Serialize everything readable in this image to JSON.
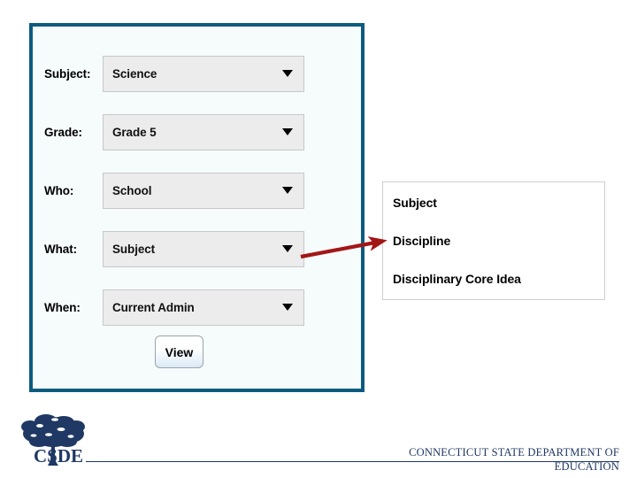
{
  "panel": {
    "title_bar": "",
    "rows": [
      {
        "label": "Subject:",
        "value": "Science",
        "name": "subject"
      },
      {
        "label": "Grade:",
        "value": "Grade 5",
        "name": "grade"
      },
      {
        "label": "Who:",
        "value": "School",
        "name": "who"
      },
      {
        "label": "What:",
        "value": "Subject",
        "name": "what"
      },
      {
        "label": "When:",
        "value": "Current Admin",
        "name": "when"
      }
    ],
    "view_button_label": "View"
  },
  "callout": {
    "lines": [
      "Subject",
      "Discipline",
      "Disciplinary Core Idea"
    ]
  },
  "footer": {
    "wordmark": "CSDE",
    "agency_line1": "CONNECTICUT STATE DEPARTMENT OF",
    "agency_line2": "EDUCATION"
  },
  "colors": {
    "panel_border": "#0d5b80",
    "panel_background": "#f6fbfc",
    "select_background": "#ececec",
    "arrow_red": "#a31616",
    "footer_navy": "#1f3864"
  },
  "icons": {
    "caret": "chevron-down-icon",
    "arrow": "red-pointer-arrow-icon",
    "logo": "csde-tree-logo-icon"
  }
}
